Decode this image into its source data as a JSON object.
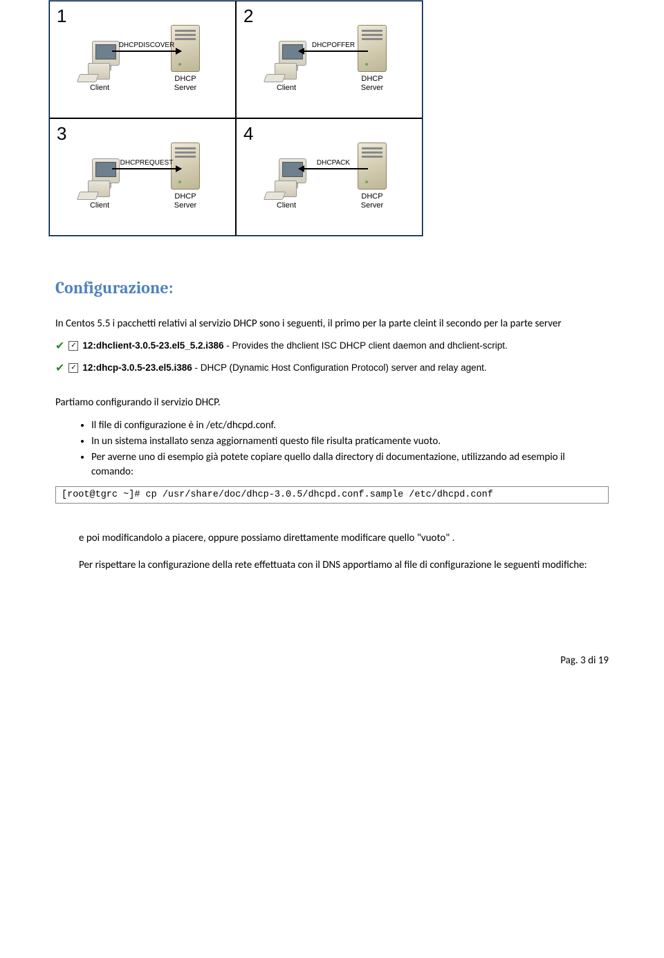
{
  "diagram": {
    "quads": [
      {
        "num": "1",
        "msg": "DHCPDISCOVER",
        "dir": "right",
        "left": "Client",
        "right": "DHCP\nServer"
      },
      {
        "num": "2",
        "msg": "DHCPOFFER",
        "dir": "left",
        "left": "Client",
        "right": "DHCP\nServer"
      },
      {
        "num": "3",
        "msg": "DHCPREQUEST",
        "dir": "right",
        "left": "Client",
        "right": "DHCP\nServer"
      },
      {
        "num": "4",
        "msg": "DHCPACK",
        "dir": "left",
        "left": "Client",
        "right": "DHCP\nServer"
      }
    ]
  },
  "heading": "Configurazione:",
  "intro": "In Centos 5.5 i pacchetti relativi al servizio DHCP sono i seguenti, il primo per la parte cleint il secondo per la parte server",
  "packages": [
    {
      "name": "12:dhclient-3.0.5-23.el5_5.2.i386",
      "desc": " - Provides the dhclient ISC DHCP client daemon and dhclient-script."
    },
    {
      "name": "12:dhcp-3.0.5-23.el5.i386",
      "desc": " - DHCP (Dynamic Host Configuration Protocol) server and relay agent."
    }
  ],
  "after_packages": "Partiamo configurando il servizio DHCP.",
  "bullets": [
    "Il file di configurazione è in /etc/dhcpd.conf.",
    "In un sistema installato senza aggiornamenti questo file risulta praticamente vuoto.",
    "Per averne uno di esempio già potete copiare quello dalla directory di documentazione, utilizzando ad esempio il comando:"
  ],
  "terminal": "[root@tgrc ~]# cp /usr/share/doc/dhcp-3.0.5/dhcpd.conf.sample /etc/dhcpd.conf",
  "para_indent1": "e poi modificandolo a piacere, oppure possiamo direttamente modificare quello \"vuoto\" .",
  "para_indent2": "Per rispettare la configurazione della rete effettuata con il DNS apportiamo al file di configurazione le seguenti modifiche:",
  "footer": "Pag. 3 di 19"
}
